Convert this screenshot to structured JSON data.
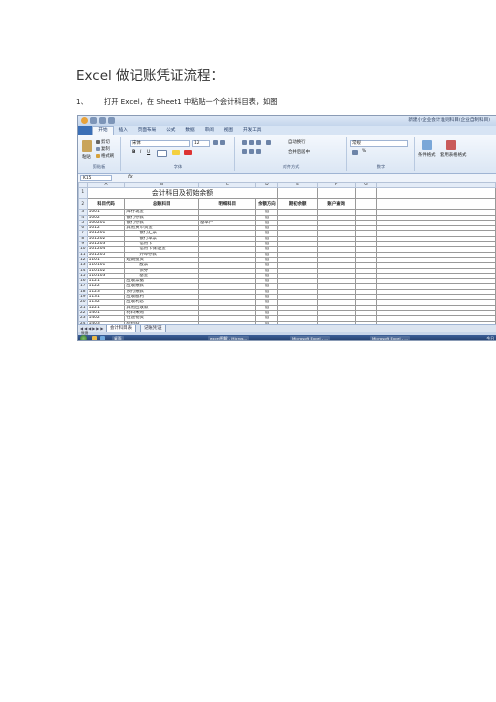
{
  "doc": {
    "title": "Excel 做记账凭证流程：",
    "step_num": "1、",
    "step_text": "打开 Excel，在 Sheet1 中粘贴一个会计科目表，如图"
  },
  "excel": {
    "window_title": "新建小企业会计准则科目(企业自制科目)",
    "tabs": [
      "开始",
      "插入",
      "页面布局",
      "公式",
      "数据",
      "审阅",
      "视图",
      "开发工具"
    ],
    "ribbon": {
      "clipboard": {
        "paste": "粘贴",
        "cut": "剪切",
        "copy": "复制",
        "painter": "格式刷",
        "label": "剪贴板"
      },
      "font": {
        "name": "宋体",
        "size": "12",
        "bold": "B",
        "italic": "I",
        "underline": "U",
        "label": "字体"
      },
      "alignment": {
        "wrap": "自动换行",
        "merge": "合并后居中",
        "label": "对齐方式"
      },
      "number": {
        "format": "常规",
        "percent": "%",
        "label": "数字"
      },
      "styles": {
        "conditional": "条件格式",
        "table": "套用表格格式"
      }
    },
    "name_box": "K15",
    "fx": "fx",
    "columns": [
      "A",
      "B",
      "C",
      "D",
      "E",
      "F",
      "G"
    ],
    "sheet_title": "会计科目及初始余额",
    "headers": [
      "科目代码",
      "总账科目",
      "明细科目",
      "余额方向",
      "期初余额",
      "账户查询"
    ],
    "rows": [
      {
        "n": "3",
        "code": "1001",
        "name": "库存现金",
        "detail": "",
        "dir": "借"
      },
      {
        "n": "4",
        "code": "1002",
        "name": "银行存款",
        "detail": "",
        "dir": "借"
      },
      {
        "n": "5",
        "code": "100201",
        "name": "银行存款",
        "detail": "基本户",
        "dir": "借"
      },
      {
        "n": "6",
        "code": "1012",
        "name": "其他货币资金",
        "detail": "",
        "dir": "借"
      },
      {
        "n": "7",
        "code": "101201",
        "name": "银行汇票",
        "indent": true,
        "detail": "",
        "dir": "借"
      },
      {
        "n": "8",
        "code": "101202",
        "name": "银行本票",
        "indent": true,
        "detail": "",
        "dir": "借"
      },
      {
        "n": "9",
        "code": "101203",
        "name": "信用卡",
        "indent": true,
        "detail": "",
        "dir": "借"
      },
      {
        "n": "10",
        "code": "101204",
        "name": "信用卡保证金",
        "indent": true,
        "detail": "",
        "dir": "借"
      },
      {
        "n": "11",
        "code": "101205",
        "name": "外埠存款",
        "indent": true,
        "detail": "",
        "dir": "借"
      },
      {
        "n": "12",
        "code": "1101",
        "name": "短期投资",
        "detail": "",
        "dir": "借"
      },
      {
        "n": "13",
        "code": "110101",
        "name": "股票",
        "indent": true,
        "detail": "",
        "dir": "借"
      },
      {
        "n": "14",
        "code": "110102",
        "name": "债券",
        "indent": true,
        "detail": "",
        "dir": "借"
      },
      {
        "n": "15",
        "code": "110103",
        "name": "基金",
        "indent": true,
        "detail": "",
        "dir": "借"
      },
      {
        "n": "16",
        "code": "1121",
        "name": "应收票据",
        "detail": "",
        "dir": "借"
      },
      {
        "n": "17",
        "code": "1122",
        "name": "应收账款",
        "detail": "",
        "dir": "借"
      },
      {
        "n": "18",
        "code": "1123",
        "name": "预付账款",
        "detail": "",
        "dir": "借"
      },
      {
        "n": "19",
        "code": "1131",
        "name": "应收股利",
        "detail": "",
        "dir": "借"
      },
      {
        "n": "20",
        "code": "1132",
        "name": "应收利息",
        "detail": "",
        "dir": "借"
      },
      {
        "n": "21",
        "code": "1221",
        "name": "其他应收款",
        "detail": "",
        "dir": "借"
      },
      {
        "n": "22",
        "code": "1401",
        "name": "材料采购",
        "detail": "",
        "dir": "借"
      },
      {
        "n": "23",
        "code": "1402",
        "name": "在途物资",
        "detail": "",
        "dir": "借"
      },
      {
        "n": "24",
        "code": "1403",
        "name": "原材料",
        "detail": "",
        "dir": "借"
      },
      {
        "n": "25",
        "code": "1404",
        "name": "材料成本差异",
        "detail": "",
        "dir": "借"
      },
      {
        "n": "26",
        "code": "1405",
        "name": "库存商品",
        "detail": "",
        "dir": "借"
      },
      {
        "n": "27",
        "code": "1407",
        "name": "商品进销差价",
        "detail": "",
        "dir": "借"
      },
      {
        "n": "28",
        "code": "1408",
        "name": "委托加工物资",
        "detail": "",
        "dir": "借"
      },
      {
        "n": "29",
        "code": "1411",
        "name": "周转材料",
        "detail": "",
        "dir": "借"
      },
      {
        "n": "30",
        "code": "141101",
        "name": "在库",
        "indent": true,
        "detail": "",
        "dir": "借"
      }
    ],
    "sheet_tabs": [
      "会计科目表",
      "记账凭证"
    ],
    "status": "就绪",
    "taskbar": [
      "桌面",
      "excel图解 - Micros...",
      "Microsoft Excel - ...",
      "Microsoft Excel - ..."
    ],
    "clock": "今日"
  }
}
